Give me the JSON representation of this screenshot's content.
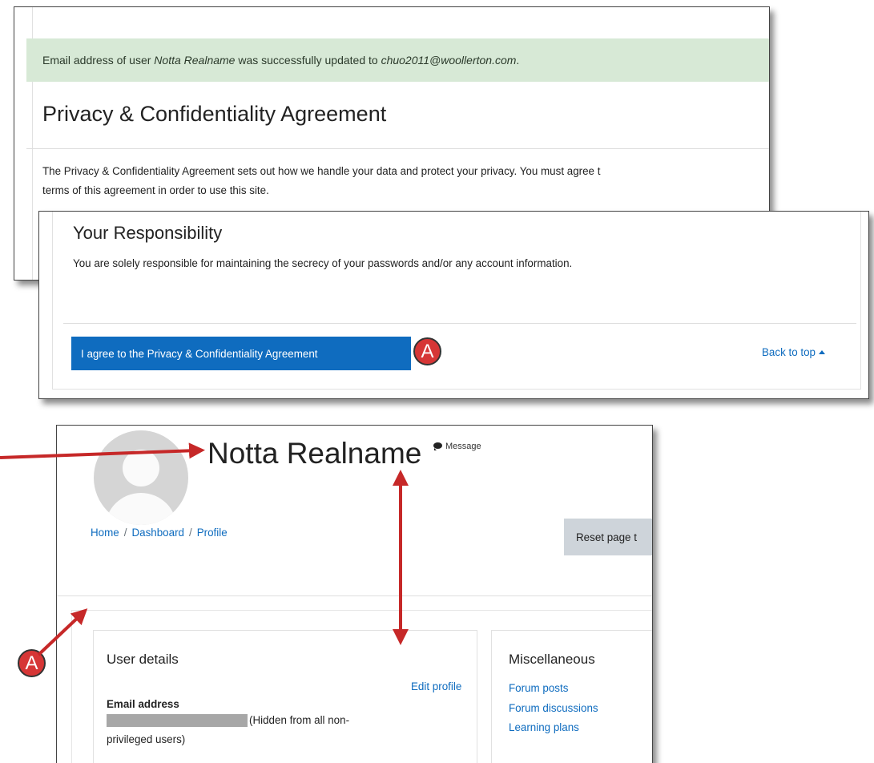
{
  "privacy_screen": {
    "alert": {
      "prefix": "Email address of user ",
      "user": "Notta Realname",
      "middle": " was successfully updated to ",
      "email": "chuo2011@woollerton.com",
      "suffix": "."
    },
    "heading": "Privacy & Confidentiality Agreement",
    "body_line1": "The Privacy & Confidentiality Agreement sets out how we handle your data and protect your privacy. You must agree t",
    "body_line2": "terms of this agreement in order to use this site."
  },
  "responsibility_screen": {
    "heading": "Your Responsibility",
    "body": "You are solely responsible for maintaining the secrecy of your passwords and/or any account information.",
    "agree_button": "I agree to the Privacy & Confidentiality Agreement",
    "back_to_top": "Back to top"
  },
  "callouts": {
    "label": "A",
    "color": "#d63636"
  },
  "profile_screen": {
    "user_name": "Notta Realname",
    "message_label": "Message",
    "breadcrumb": [
      "Home",
      "Dashboard",
      "Profile"
    ],
    "reset_button": "Reset page t",
    "user_details": {
      "title": "User details",
      "edit_profile": "Edit profile",
      "email_label": "Email address",
      "hidden_note_line1": "(Hidden from all non-",
      "hidden_note_line2": "privileged users)"
    },
    "miscellaneous": {
      "title": "Miscellaneous",
      "links": [
        "Forum posts",
        "Forum discussions",
        "Learning plans"
      ]
    }
  },
  "colors": {
    "accent": "#0f6cbf",
    "alert_background": "#d7e9d6",
    "arrow": "#c62828"
  }
}
